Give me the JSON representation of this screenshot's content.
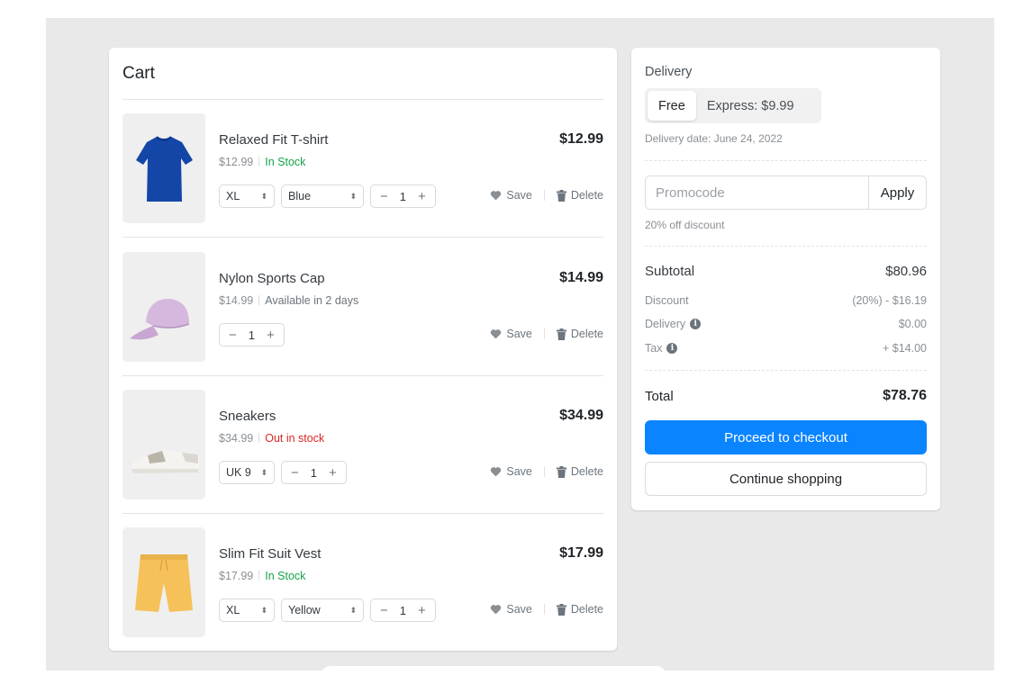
{
  "cart": {
    "title": "Cart",
    "items": [
      {
        "name": "Relaxed Fit T-shirt",
        "unit_price": "$12.99",
        "stock": "In Stock",
        "stock_status": "in",
        "total": "$12.99",
        "size": "XL",
        "color": "Blue",
        "qty": "1",
        "save_label": "Save",
        "delete_label": "Delete"
      },
      {
        "name": "Nylon Sports Cap",
        "unit_price": "$14.99",
        "stock": "Available in 2 days",
        "stock_status": "info",
        "total": "$14.99",
        "qty": "1",
        "save_label": "Save",
        "delete_label": "Delete"
      },
      {
        "name": "Sneakers",
        "unit_price": "$34.99",
        "stock": "Out in stock",
        "stock_status": "out",
        "total": "$34.99",
        "size": "UK 9",
        "qty": "1",
        "save_label": "Save",
        "delete_label": "Delete"
      },
      {
        "name": "Slim Fit Suit Vest",
        "unit_price": "$17.99",
        "stock": "In Stock",
        "stock_status": "in",
        "total": "$17.99",
        "size": "XL",
        "color": "Yellow",
        "qty": "1",
        "save_label": "Save",
        "delete_label": "Delete"
      }
    ]
  },
  "summary": {
    "delivery_label": "Delivery",
    "delivery_options": [
      "Free",
      "Express: $9.99"
    ],
    "delivery_selected": "Free",
    "delivery_date": "Delivery date: June 24, 2022",
    "promo_placeholder": "Promocode",
    "promo_apply": "Apply",
    "promo_note": "20% off discount",
    "subtotal_label": "Subtotal",
    "subtotal_value": "$80.96",
    "discount_label": "Discount",
    "discount_value": "(20%) - $16.19",
    "delivery_row_label": "Delivery",
    "delivery_row_value": "$0.00",
    "tax_label": "Tax",
    "tax_value": "+ $14.00",
    "total_label": "Total",
    "total_value": "$78.76",
    "checkout_label": "Proceed to checkout",
    "continue_label": "Continue shopping"
  },
  "colors": {
    "accent": "#0a84ff",
    "in_stock": "#17a34a",
    "out_of_stock": "#dc2626",
    "background": "#e9e9e9"
  },
  "icons": {
    "save": "heart-icon",
    "delete": "trash-icon",
    "info": "info-icon",
    "select": "updown-caret-icon"
  }
}
